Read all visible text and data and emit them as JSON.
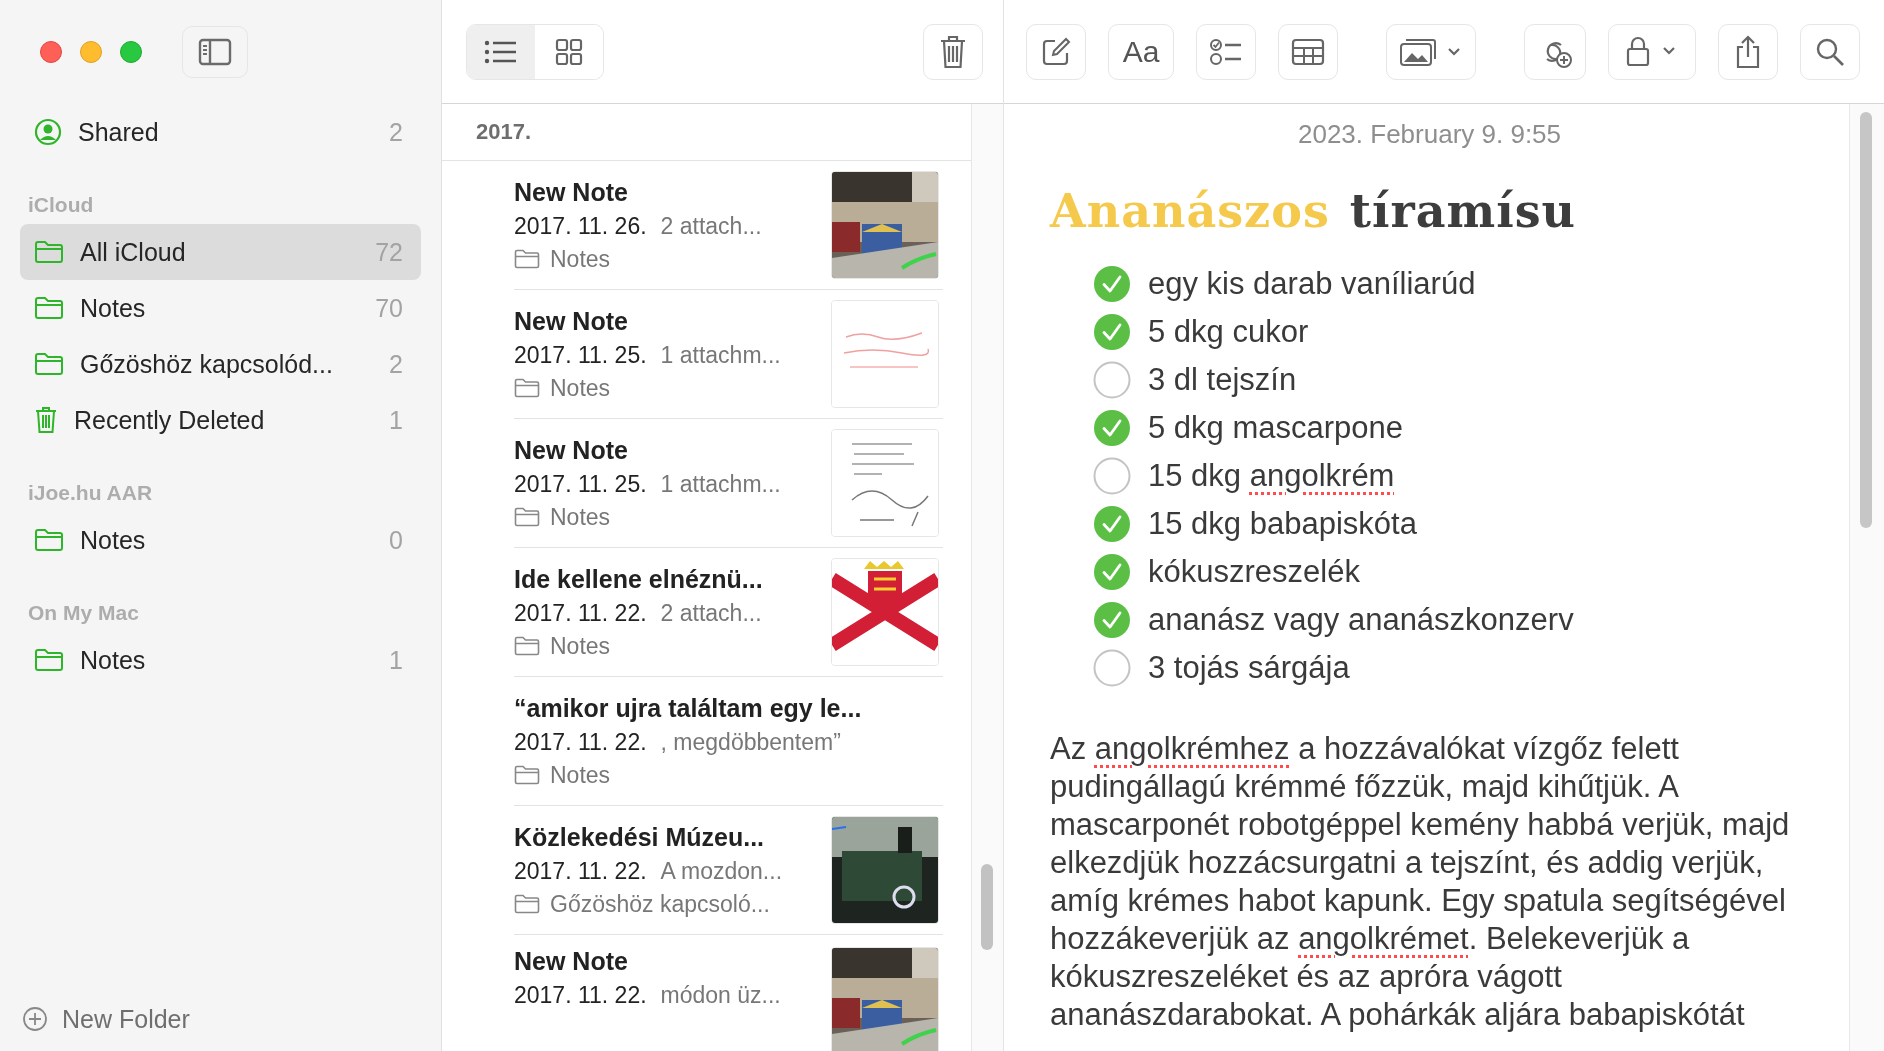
{
  "sidebar": {
    "sections": [
      {
        "items": [
          {
            "kind": "person",
            "label": "Shared",
            "count": "2",
            "selected": false
          }
        ]
      },
      {
        "header": "iCloud",
        "items": [
          {
            "kind": "folder",
            "label": "All iCloud",
            "count": "72",
            "selected": true
          },
          {
            "kind": "folder",
            "label": "Notes",
            "count": "70",
            "selected": false
          },
          {
            "kind": "folder",
            "label": "Gőzöshöz kapcsolód...",
            "count": "2",
            "selected": false
          },
          {
            "kind": "trash",
            "label": "Recently Deleted",
            "count": "1",
            "selected": false
          }
        ]
      },
      {
        "header": "iJoe.hu AAR",
        "items": [
          {
            "kind": "folder",
            "label": "Notes",
            "count": "0",
            "selected": false
          }
        ]
      },
      {
        "header": "On My Mac",
        "items": [
          {
            "kind": "folder",
            "label": "Notes",
            "count": "1",
            "selected": false
          }
        ]
      }
    ],
    "new_folder": "New Folder"
  },
  "view_toggle": [
    {
      "kind": "list",
      "selected": true
    },
    {
      "kind": "grid",
      "selected": false
    }
  ],
  "note_list": {
    "group": "2017.",
    "notes": [
      {
        "title": "New Note",
        "date": "2017. 11. 26.",
        "snippet": "2 attach...",
        "folder": "Notes"
      },
      {
        "title": "New Note",
        "date": "2017. 11. 25.",
        "snippet": "1 attachm...",
        "folder": "Notes"
      },
      {
        "title": "New Note",
        "date": "2017. 11. 25.",
        "snippet": "1 attachm...",
        "folder": "Notes"
      },
      {
        "title": "Ide kellene elnéznü...",
        "date": "2017. 11. 22.",
        "snippet": "2 attach...",
        "folder": "Notes"
      },
      {
        "title": "“amikor ujra találtam egy le...",
        "date": "2017. 11. 22.",
        "snippet": ", megdöbbentem”",
        "folder": "Notes"
      },
      {
        "title": "Közlekedési Múzeu...",
        "date": "2017. 11. 22.",
        "snippet": "A mozdon...",
        "folder": "Gőzöshöz kapcsoló..."
      },
      {
        "title": "New Note",
        "date": "2017. 11. 22.",
        "snippet": "módon üz..."
      }
    ]
  },
  "editor": {
    "format_button": "Aa",
    "date": "2023. February 9. 9:55",
    "title": [
      {
        "text": "Ananászos",
        "color": "#f5c94c"
      },
      {
        "text": "tíramísu",
        "color": "#3d3d3d"
      }
    ],
    "checklist": [
      {
        "checked": true,
        "parts": [
          {
            "text": "egy kis darab vaníliarúd",
            "misspelled": false
          }
        ]
      },
      {
        "checked": true,
        "parts": [
          {
            "text": "5 dkg cukor",
            "misspelled": false
          }
        ]
      },
      {
        "checked": false,
        "parts": [
          {
            "text": "3 dl tejszín",
            "misspelled": false
          }
        ]
      },
      {
        "checked": true,
        "parts": [
          {
            "text": "5 dkg mascarpone",
            "misspelled": false
          }
        ]
      },
      {
        "checked": false,
        "parts": [
          {
            "text": "15 dkg ",
            "misspelled": false
          },
          {
            "text": "angolkrém",
            "misspelled": true
          }
        ]
      },
      {
        "checked": true,
        "parts": [
          {
            "text": "15 dkg babapiskóta",
            "misspelled": false
          }
        ]
      },
      {
        "checked": true,
        "parts": [
          {
            "text": "kókuszreszelék",
            "misspelled": false
          }
        ]
      },
      {
        "checked": true,
        "parts": [
          {
            "text": "ananász vagy ananászkonzerv",
            "misspelled": false
          }
        ]
      },
      {
        "checked": false,
        "parts": [
          {
            "text": "3 tojás sárgája",
            "misspelled": false
          }
        ]
      }
    ],
    "body": [
      {
        "text": "Az ",
        "misspelled": false
      },
      {
        "text": "angolkrémhez",
        "misspelled": true
      },
      {
        "text": " a hozzávalókat vízgőz felett pudingállagú krémmé főzzük, majd kihűtjük. A mascarponét robotgéppel kemény habbá verjük, majd elkezdjük hozzácsurgatni a tejszínt, és addig verjük, amíg krémes habot kapunk. Egy spatula segítségével hozzákeverjük az ",
        "misspelled": false
      },
      {
        "text": "angolkrémet",
        "misspelled": true
      },
      {
        "text": ". Belekeverjük a kókuszreszeléket és az apróra vágott ananászdarabokat. A pohárkák aljára babapiskótát",
        "misspelled": false
      }
    ]
  }
}
